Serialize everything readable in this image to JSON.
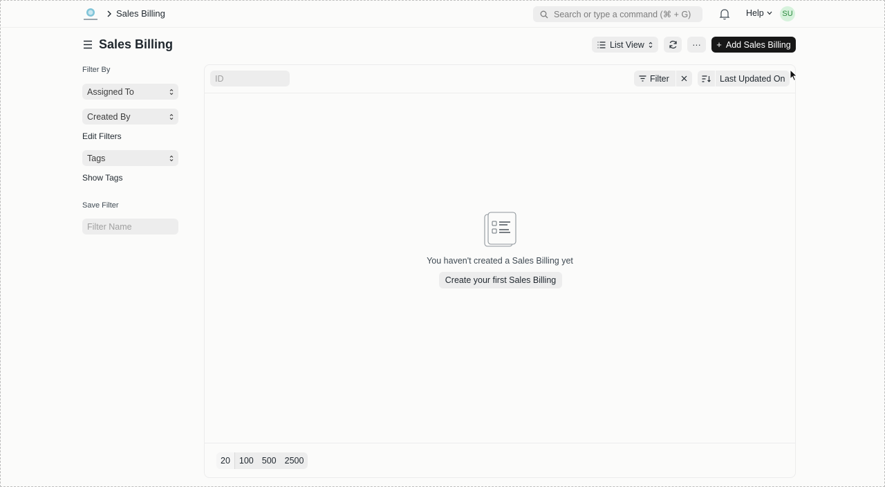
{
  "navbar": {
    "breadcrumb": "Sales Billing",
    "search_placeholder": "Search or type a command (⌘ + G)",
    "help_label": "Help",
    "avatar_initials": "SU",
    "logo_icon": "company-logo-icon"
  },
  "page": {
    "title": "Sales Billing",
    "list_view_label": "List View",
    "add_button_label": "Add Sales Billing",
    "more_label": "···"
  },
  "sidebar": {
    "filter_by_label": "Filter By",
    "assigned_to": "Assigned To",
    "created_by": "Created By",
    "edit_filters": "Edit Filters",
    "tags": "Tags",
    "show_tags": "Show Tags",
    "save_filter_label": "Save Filter",
    "filter_name_placeholder": "Filter Name"
  },
  "list": {
    "id_placeholder": "ID",
    "filter_label": "Filter",
    "sort_label": "Last Updated On",
    "empty_message": "You haven't created a Sales Billing yet",
    "create_first_label": "Create your first Sales Billing",
    "page_sizes": [
      "20",
      "100",
      "500",
      "2500"
    ],
    "active_page_size": "20"
  },
  "colors": {
    "primary_button": "#171717",
    "avatar_bg": "#d6f2dc",
    "avatar_fg": "#2b8a3e",
    "control_bg": "#ededed"
  }
}
